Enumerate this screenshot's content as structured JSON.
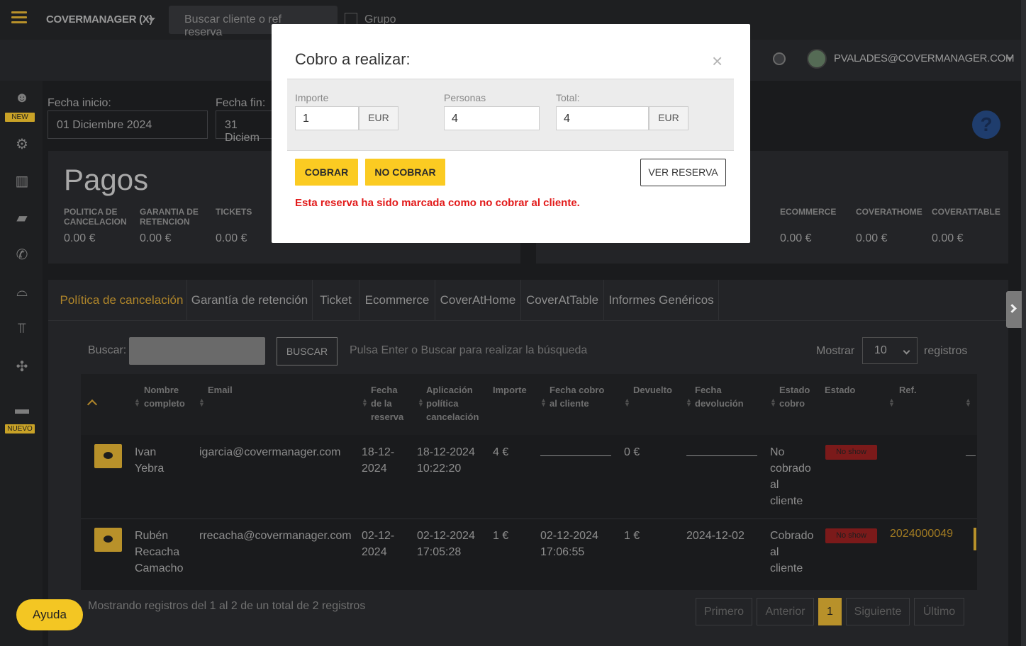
{
  "topbar": {
    "brand": "COVERMANAGER (X)",
    "search_placeholder": "Buscar cliente o ref reserva",
    "grupo_label": "Grupo",
    "user_email": "PVALADES@COVERMANAGER.COM"
  },
  "sidebar": {
    "badge_new": "NEW",
    "badge_nuevo": "NUEVO",
    "icons": [
      "face-icon",
      "gear-icon",
      "chart-icon",
      "truck-icon",
      "phone-icon",
      "cloche-icon",
      "table-icon",
      "puzzle-icon",
      "ticket-icon"
    ]
  },
  "filters": {
    "start_label": "Fecha inicio:",
    "start_value": "01 Diciembre 2024",
    "end_label": "Fecha fin:",
    "end_value": "31 Diciem"
  },
  "payments": {
    "title": "Pagos",
    "left_stats": [
      {
        "label": "POLITICA DE CANCELACION",
        "value": "0.00 €"
      },
      {
        "label": "GARANTIA DE RETENCION",
        "value": "0.00 €"
      },
      {
        "label": "TICKETS",
        "value": "0.00 €"
      }
    ],
    "right_stats": [
      {
        "label": "ECOMMERCE",
        "value": "0.00 €"
      },
      {
        "label": "COVERATHOME",
        "value": "0.00 €"
      },
      {
        "label": "COVERATTABLE",
        "value": "0.00 €"
      }
    ]
  },
  "tabs": [
    "Política de cancelación",
    "Garantía de retención",
    "Ticket",
    "Ecommerce",
    "CoverAtHome",
    "CoverAtTable",
    "Informes Genéricos"
  ],
  "table_controls": {
    "search_label": "Buscar:",
    "search_button": "BUSCAR",
    "hint": "Pulsa Enter o Buscar para realizar la búsqueda",
    "show_label": "Mostrar",
    "show_value": "10",
    "records_label": "registros"
  },
  "table": {
    "headers": {
      "name": [
        "Nombre",
        "completo"
      ],
      "email": "Email",
      "fecha_reserva": [
        "Fecha",
        "de la",
        "reserva"
      ],
      "aplicacion": [
        "Aplicación",
        "política",
        "cancelación"
      ],
      "importe": "Importe",
      "fecha_cobro": [
        "Fecha cobro",
        "al cliente"
      ],
      "devuelto": "Devuelto",
      "fecha_devolucion": [
        "Fecha",
        "devolución"
      ],
      "estado_cobro": [
        "Estado",
        "cobro"
      ],
      "estado": "Estado",
      "ref": "Ref."
    },
    "rows": [
      {
        "name": [
          "Ivan",
          "Yebra"
        ],
        "email": "igarcia@covermanager.com",
        "fecha_reserva": [
          "18-12-",
          "2024"
        ],
        "aplicacion": [
          "18-12-2024",
          "10:22:20"
        ],
        "importe": "4 €",
        "devuelto": "0 €",
        "estado_cobro": [
          "No",
          "cobrado",
          "al",
          "cliente"
        ],
        "estado": "No show"
      },
      {
        "name": [
          "Rubén",
          "Recacha",
          "Camacho"
        ],
        "email": "rrecacha@covermanager.com",
        "fecha_reserva": [
          "02-12-",
          "2024"
        ],
        "aplicacion": [
          "02-12-2024",
          "17:05:28"
        ],
        "importe": "1 €",
        "fecha_cobro": [
          "02-12-2024",
          "17:06:55"
        ],
        "devuelto": "1 €",
        "fecha_devolucion": "2024-12-02",
        "estado_cobro": [
          "Cobrado",
          "al",
          "cliente"
        ],
        "estado": "No show",
        "ref": "2024000049"
      }
    ]
  },
  "footer": {
    "summary": "Mostrando registros del 1 al 2 de un total de 2 registros",
    "pager": [
      "Primero",
      "Anterior",
      "1",
      "Siguiente",
      "Último"
    ]
  },
  "help_button": "Ayuda",
  "modal": {
    "title": "Cobro a realizar:",
    "close": "×",
    "importe_label": "Importe",
    "importe_value": "1",
    "currency": "EUR",
    "personas_label": "Personas",
    "personas_value": "4",
    "total_label": "Total:",
    "total_value": "4",
    "cobrar": "COBRAR",
    "no_cobrar": "NO COBRAR",
    "ver_reserva": "VER RESERVA",
    "warning": "Esta reserva ha sido marcada como no cobrar al cliente."
  },
  "colors": {
    "accent": "#fbcb22",
    "warning": "#e21b1b",
    "background": "#1a1b1d"
  }
}
